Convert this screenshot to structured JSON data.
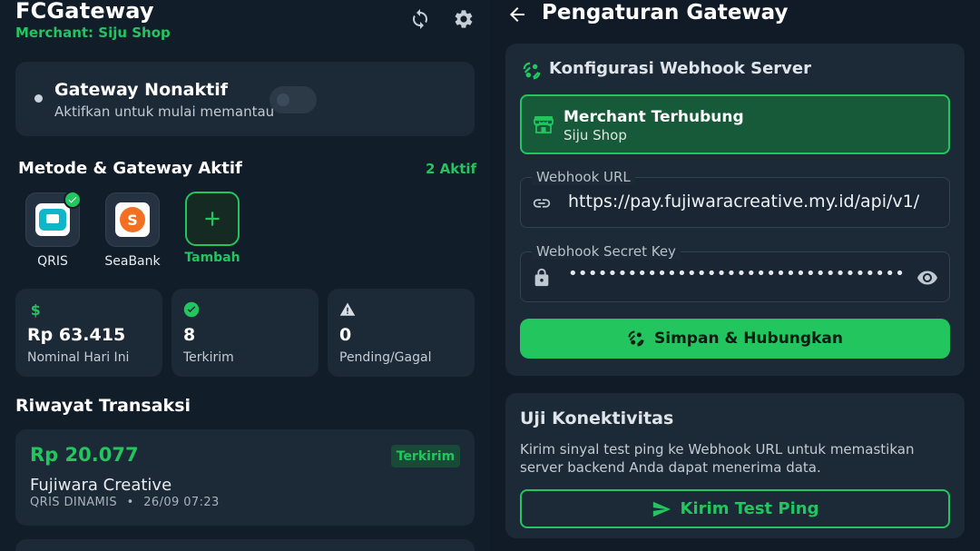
{
  "left": {
    "app_title": "FCGateway",
    "merchant_line": "Merchant: Siju Shop",
    "header_icons": [
      "sync-icon",
      "gear-icon"
    ],
    "gateway": {
      "title": "Gateway Nonaktif",
      "subtitle": "Aktifkan untuk mulai memantau",
      "enabled": false
    },
    "methods_header": "Metode & Gateway Aktif",
    "active_count": "2 Aktif",
    "methods": [
      {
        "label": "QRIS",
        "icon": "qris-logo",
        "active": true
      },
      {
        "label": "SeaBank",
        "icon": "seabank-logo",
        "active": false
      }
    ],
    "add_label": "Tambah",
    "stats": [
      {
        "icon": "dollar-icon",
        "value": "Rp 63.415",
        "label": "Nominal Hari Ini",
        "color": "#22c55e"
      },
      {
        "icon": "check-circle-icon",
        "value": "8",
        "label": "Terkirim",
        "color": "#22c55e"
      },
      {
        "icon": "warning-icon",
        "value": "0",
        "label": "Pending/Gagal",
        "color": "#d8dde3"
      }
    ],
    "history_header": "Riwayat Transaksi",
    "transactions": [
      {
        "amount": "Rp 20.077",
        "status": "Terkirim",
        "name": "Fujiwara Creative",
        "method": "QRIS DINAMIS",
        "sep": "•",
        "time": "26/09 07:23"
      }
    ]
  },
  "right": {
    "page_title": "Pengaturan Gateway",
    "config": {
      "title": "Konfigurasi Webhook Server",
      "merchant_title": "Merchant Terhubung",
      "merchant_name": "Siju Shop",
      "url_label": "Webhook URL",
      "url_value": "https://pay.fujiwaracreative.my.id/api/v1/",
      "secret_label": "Webhook Secret Key",
      "secret_value": "••••••••••••••••••••••••••••••••••••••••••",
      "save_label": "Simpan & Hubungkan"
    },
    "test": {
      "title": "Uji Konektivitas",
      "description": "Kirim sinyal test ping ke Webhook URL untuk memastikan server backend Anda dapat menerima data.",
      "button_label": "Kirim Test Ping"
    }
  },
  "colors": {
    "accent": "#22c55e",
    "background": "#121d2a",
    "card": "#1c2937"
  }
}
